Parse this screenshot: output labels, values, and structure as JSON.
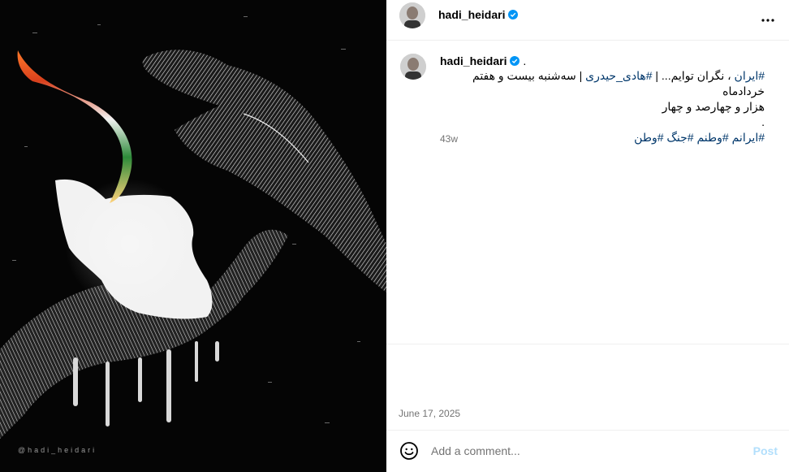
{
  "post": {
    "username": "hadi_heidari",
    "verified_icon": "verified-badge-icon",
    "more_icon": "more-options-icon",
    "image_watermark": "@hadi_heidari",
    "caption": {
      "username": "hadi_heidari",
      "suffix": ".",
      "line1_hashtag_iran": "#ایران",
      "line1_text1": " ، نگران توایم... | ",
      "line1_hashtag_name": "#هادی_حیدری",
      "line1_text2": " | سه‌شنبه بیست و هفتم خردادماه",
      "line2": "هزار و چهارصد و چهار",
      "line3": ".",
      "hashtags": "#ایرانم #وطنم #جنگ #وطن"
    },
    "time_ago": "43w",
    "date": "June 17, 2025"
  },
  "comment": {
    "placeholder": "Add a comment...",
    "post_label": "Post",
    "emoji_icon": "emoji-icon"
  },
  "colors": {
    "link": "#00376b",
    "verified": "#0095f6",
    "post_disabled": "#b2dffc",
    "muted": "#737373"
  }
}
